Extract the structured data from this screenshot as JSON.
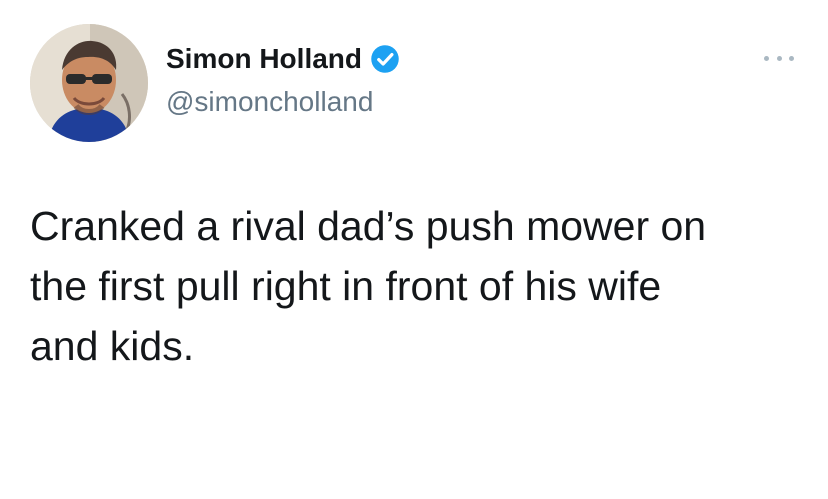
{
  "user": {
    "display_name": "Simon Holland",
    "handle": "@simoncholland",
    "verified": true,
    "avatar_icon": "profile-photo"
  },
  "menu": {
    "icon": "more-options-icon"
  },
  "tweet": {
    "text": "Cranked a rival dad’s push mower on\nthe first pull right in front of his wife\nand kids."
  },
  "colors": {
    "verified": "#1da1f2",
    "text": "#14171a",
    "secondary_text": "#657786"
  }
}
